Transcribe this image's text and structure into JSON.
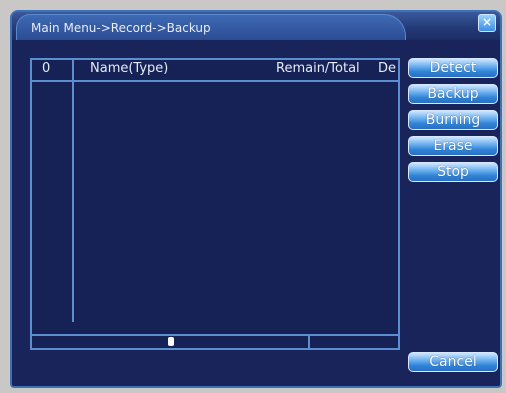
{
  "window": {
    "title": "Main Menu->Record->Backup",
    "close_icon": "close-icon"
  },
  "file_list": {
    "headers": {
      "index": "0",
      "name": "Name(Type)",
      "remain_total": "Remain/Total",
      "device": "De"
    },
    "rows": []
  },
  "buttons": {
    "detect": "Detect",
    "backup": "Backup",
    "burning": "Burning",
    "erase": "Erase",
    "stop": "Stop",
    "cancel": "Cancel"
  },
  "colors": {
    "panel_background": "#18245a",
    "border_blue": "#5b8fd0",
    "button_blue": "#2f84d8"
  }
}
